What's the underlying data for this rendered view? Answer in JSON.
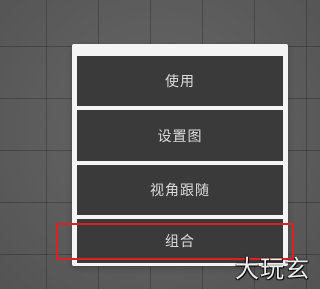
{
  "menu": {
    "items": [
      {
        "label": "使用"
      },
      {
        "label": "设置图"
      },
      {
        "label": "视角跟随"
      },
      {
        "label": "组合"
      }
    ]
  },
  "watermark": {
    "text": "大玩玄"
  }
}
